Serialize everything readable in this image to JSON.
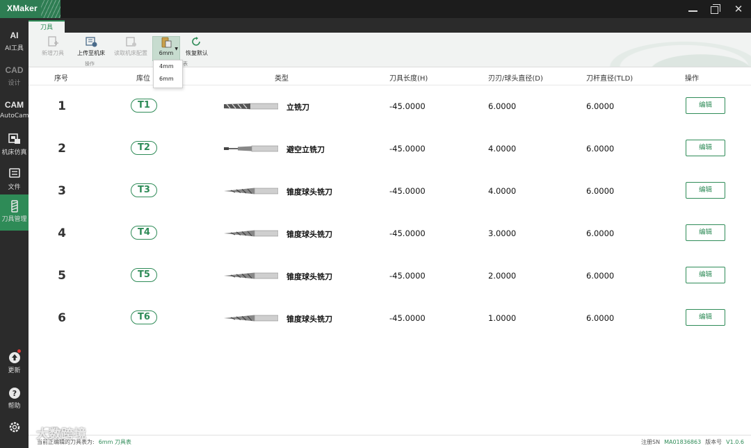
{
  "app": {
    "title": "XMaker"
  },
  "sidebar": {
    "items": [
      {
        "icon": "AI",
        "label": "AI工具"
      },
      {
        "icon": "CAD",
        "label": "设计"
      },
      {
        "icon": "CAM",
        "label": "AutoCam"
      },
      {
        "icon": "machine-sim-icon",
        "label": "机床仿真"
      },
      {
        "icon": "file-icon",
        "label": "文件"
      },
      {
        "icon": "tool-icon",
        "label": "刀具管理"
      },
      {
        "icon": "update-icon",
        "label": "更新"
      },
      {
        "icon": "help-icon",
        "label": "帮助"
      }
    ]
  },
  "ribbon": {
    "tab": "刀具",
    "buttons": {
      "add_tool": "新增刀具",
      "upload": "上传至机床",
      "read_config": "读取机床配置",
      "toolset": "6mm",
      "restore": "恢复默认"
    },
    "group_ops": "操作",
    "group_set": "表",
    "dropdown_options": [
      "4mm",
      "6mm"
    ]
  },
  "table": {
    "headers": [
      "序号",
      "库位",
      "类型",
      "刀具长度(H)",
      "刃刃/球头直径(D)",
      "刀杆直径(TLD)",
      "操作"
    ],
    "rows": [
      {
        "index": "1",
        "slot": "T1",
        "type": "立铣刀",
        "length": "-45.0000",
        "diameter": "6.0000",
        "tld": "6.0000",
        "action": "编辑",
        "tool_shape": "flat-end-mill"
      },
      {
        "index": "2",
        "slot": "T2",
        "type": "避空立铣刀",
        "length": "-45.0000",
        "diameter": "4.0000",
        "tld": "6.0000",
        "action": "编辑",
        "tool_shape": "relieved-end-mill"
      },
      {
        "index": "3",
        "slot": "T3",
        "type": "锥度球头铣刀",
        "length": "-45.0000",
        "diameter": "4.0000",
        "tld": "6.0000",
        "action": "编辑",
        "tool_shape": "tapered-ball-mill"
      },
      {
        "index": "4",
        "slot": "T4",
        "type": "锥度球头铣刀",
        "length": "-45.0000",
        "diameter": "3.0000",
        "tld": "6.0000",
        "action": "编辑",
        "tool_shape": "tapered-ball-mill"
      },
      {
        "index": "5",
        "slot": "T5",
        "type": "锥度球头铣刀",
        "length": "-45.0000",
        "diameter": "2.0000",
        "tld": "6.0000",
        "action": "编辑",
        "tool_shape": "tapered-ball-mill"
      },
      {
        "index": "6",
        "slot": "T6",
        "type": "锥度球头铣刀",
        "length": "-45.0000",
        "diameter": "1.0000",
        "tld": "6.0000",
        "action": "编辑",
        "tool_shape": "tapered-ball-mill"
      }
    ]
  },
  "status": {
    "current_table_label": "当前正编辑的刀具表为:",
    "current_table_value": "6mm 刀具表",
    "sn_label": "注册SN",
    "sn_value": "MA01836863",
    "version_label": "版本号",
    "version_value": "V1.0.6"
  },
  "watermark": "大数跨境",
  "colors": {
    "accent": "#2e8b57",
    "sidebar_bg": "#2b2b2b",
    "titlebar_bg": "#1c1c1c"
  }
}
